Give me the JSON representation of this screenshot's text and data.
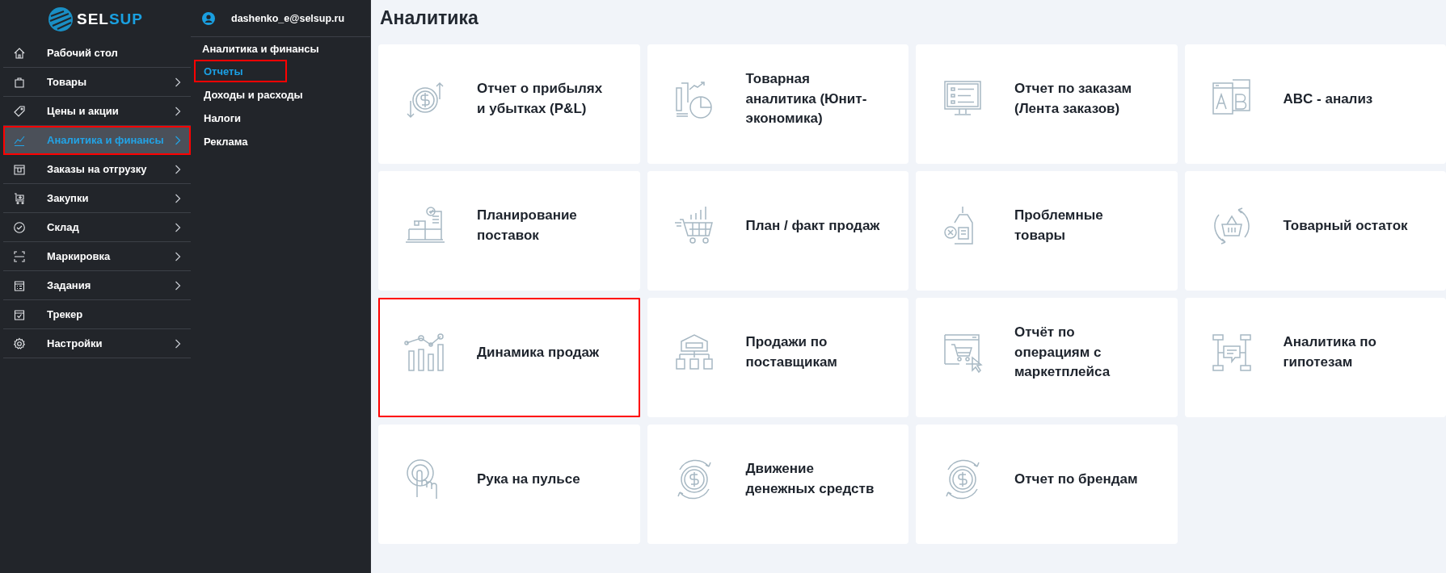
{
  "logo": {
    "part_1": "SEL",
    "part_2": "SUP"
  },
  "nav": [
    {
      "label": "Рабочий стол",
      "has_submenu": false,
      "selected": false,
      "highlighted": false
    },
    {
      "label": "Товары",
      "has_submenu": true,
      "selected": false,
      "highlighted": false
    },
    {
      "label": "Цены и акции",
      "has_submenu": true,
      "selected": false,
      "highlighted": false
    },
    {
      "label": "Аналитика и финансы",
      "has_submenu": true,
      "selected": true,
      "highlighted": true
    },
    {
      "label": "Заказы на отгрузку",
      "has_submenu": true,
      "selected": false,
      "highlighted": false
    },
    {
      "label": "Закупки",
      "has_submenu": true,
      "selected": false,
      "highlighted": false
    },
    {
      "label": "Склад",
      "has_submenu": true,
      "selected": false,
      "highlighted": false
    },
    {
      "label": "Маркировка",
      "has_submenu": true,
      "selected": false,
      "highlighted": false
    },
    {
      "label": "Задания",
      "has_submenu": true,
      "selected": false,
      "highlighted": false
    },
    {
      "label": "Трекер",
      "has_submenu": false,
      "selected": false,
      "highlighted": false
    },
    {
      "label": "Настройки",
      "has_submenu": true,
      "selected": false,
      "highlighted": false
    }
  ],
  "submenu": {
    "user": "dashenko_e@selsup.ru",
    "title": "Аналитика и финансы",
    "items": [
      {
        "label": "Отчеты",
        "selected": true,
        "highlighted": true
      },
      {
        "label": "Доходы и расходы",
        "selected": false,
        "highlighted": false
      },
      {
        "label": "Налоги",
        "selected": false,
        "highlighted": false
      },
      {
        "label": "Реклама",
        "selected": false,
        "highlighted": false
      }
    ]
  },
  "page_title": "Аналитика",
  "cards": [
    {
      "title": "Отчет о прибылях и убытках (P&L)",
      "highlighted": false
    },
    {
      "title": "Товарная аналитика (Юнит-экономика)",
      "highlighted": false
    },
    {
      "title": "Отчет по заказам (Лента заказов)",
      "highlighted": false
    },
    {
      "title": "ABC - анализ",
      "highlighted": false
    },
    {
      "title": "Планирование поставок",
      "highlighted": false
    },
    {
      "title": "План / факт продаж",
      "highlighted": false
    },
    {
      "title": "Проблемные товары",
      "highlighted": false
    },
    {
      "title": "Товарный остаток",
      "highlighted": false
    },
    {
      "title": "Динамика продаж",
      "highlighted": true
    },
    {
      "title": "Продажи по поставщикам",
      "highlighted": false
    },
    {
      "title": "Отчёт по операциям с маркетплейса",
      "highlighted": false
    },
    {
      "title": "Аналитика по гипотезам",
      "highlighted": false
    },
    {
      "title": "Рука на пульсе",
      "highlighted": false
    },
    {
      "title": "Движение денежных средств",
      "highlighted": false
    },
    {
      "title": "Отчет по брендам",
      "highlighted": false
    }
  ]
}
